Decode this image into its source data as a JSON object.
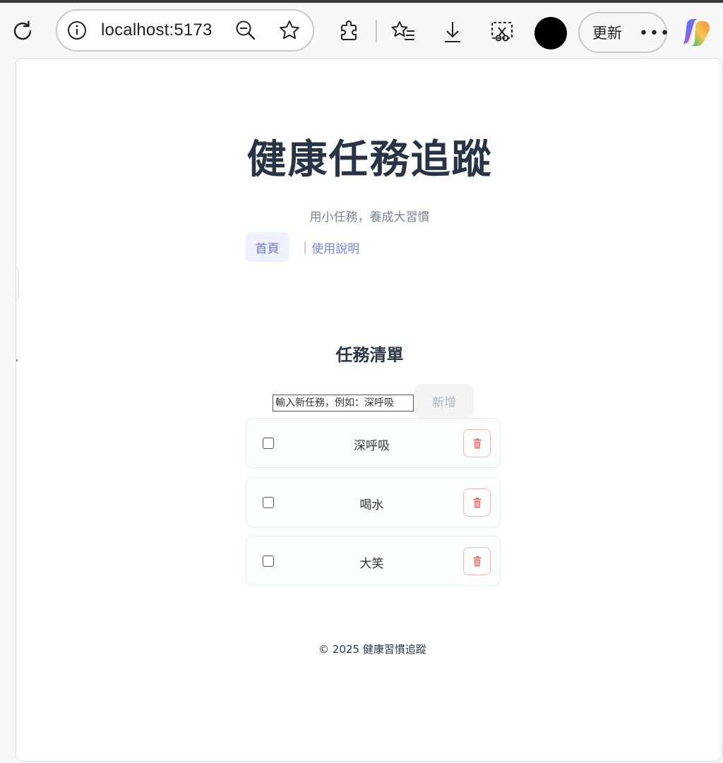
{
  "browser": {
    "url": "localhost:5173",
    "update_label": "更新",
    "more_label": "•••"
  },
  "app": {
    "title": "健康任務追蹤",
    "subtitle": "用小任務，養成大習慣",
    "nav": {
      "home": "首頁",
      "separator": "|",
      "help": "使用說明"
    }
  },
  "tasks_section": {
    "heading": "任務清單",
    "input_placeholder": "輸入新任務，例如：深呼吸",
    "add_label": "新增",
    "items": [
      {
        "text": "深呼吸",
        "done": false
      },
      {
        "text": "喝水",
        "done": false
      },
      {
        "text": "大笑",
        "done": false
      }
    ]
  },
  "footer": {
    "text": "© 2025 健康習慣追蹤"
  },
  "icons": [
    "reload-icon",
    "info-icon",
    "zoom-out-icon",
    "star-icon",
    "extensions-icon",
    "favorites-icon",
    "download-icon",
    "screenshot-icon",
    "copilot-icon",
    "trash-icon"
  ],
  "colors": {
    "accent": "#6b72db",
    "danger": "#e57373",
    "title": "#283548"
  }
}
